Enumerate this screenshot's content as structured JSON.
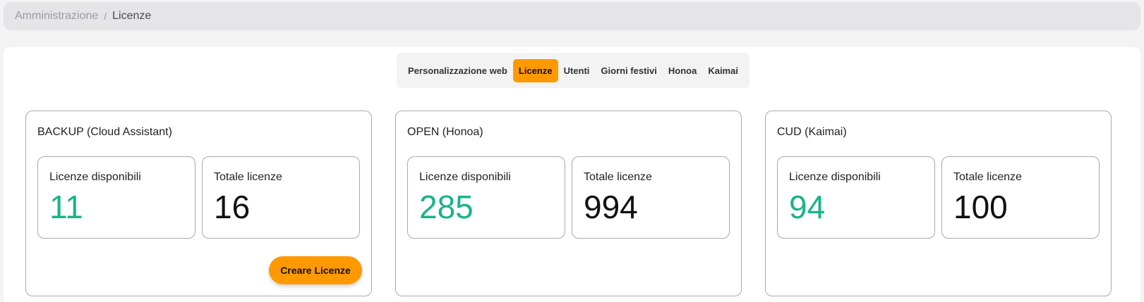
{
  "breadcrumb": {
    "root": "Amministrazione",
    "separator": "/",
    "current": "Licenze"
  },
  "tabs": [
    {
      "label": "Personalizzazione web",
      "active": false
    },
    {
      "label": "Licenze",
      "active": true
    },
    {
      "label": "Utenti",
      "active": false
    },
    {
      "label": "Giorni festivi",
      "active": false
    },
    {
      "label": "Honoa",
      "active": false
    },
    {
      "label": "Kaimai",
      "active": false
    }
  ],
  "labels": {
    "available": "Licenze disponibili",
    "total": "Totale licenze"
  },
  "cards": [
    {
      "title": "BACKUP (Cloud Assistant)",
      "available": "11",
      "total": "16",
      "button": "Creare Licenze"
    },
    {
      "title": "OPEN (Honoa)",
      "available": "285",
      "total": "994"
    },
    {
      "title": "CUD (Kaimai)",
      "available": "94",
      "total": "100"
    }
  ],
  "colors": {
    "accent": "#ff9900",
    "available_value": "#19b38a"
  }
}
